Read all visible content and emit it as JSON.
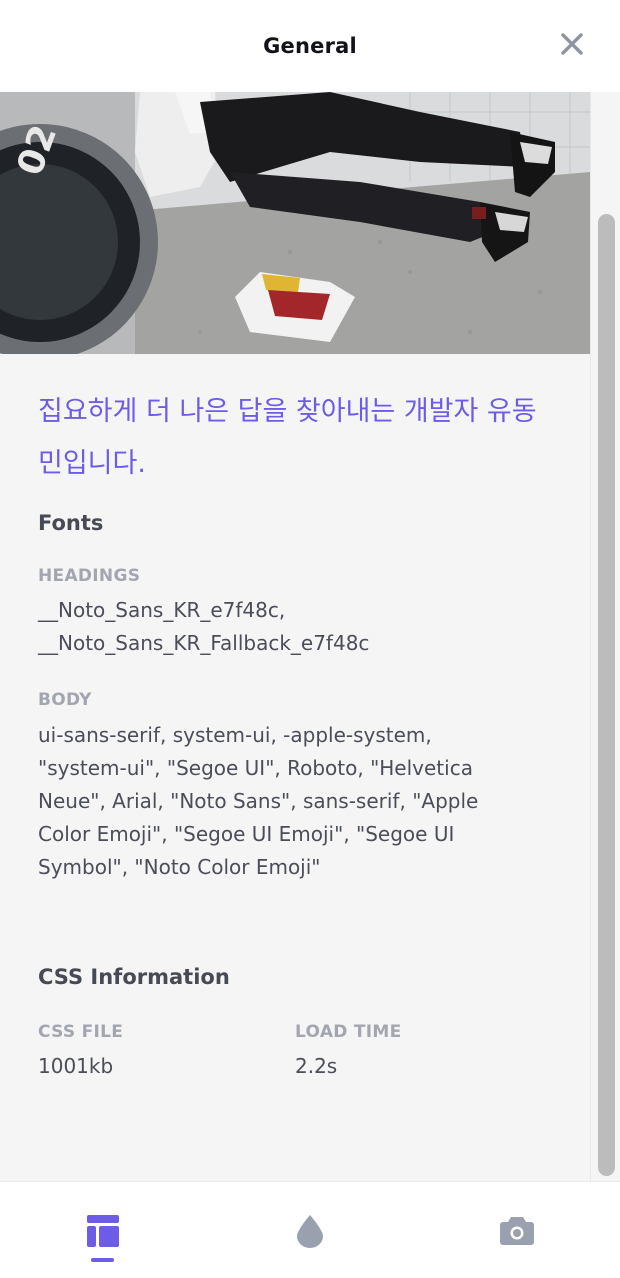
{
  "header": {
    "title": "General"
  },
  "hero": {
    "image": "person-lying-on-floor-photo"
  },
  "tagline": "집요하게 더 나은 답을 찾아내는 개발자 유동민입니다.",
  "fonts": {
    "title": "Fonts",
    "headings_label": "HEADINGS",
    "headings_value": "__Noto_Sans_KR_e7f48c, __Noto_Sans_KR_Fallback_e7f48c",
    "body_label": "BODY",
    "body_value": "ui-sans-serif, system-ui, -apple-system, \"system-ui\", \"Segoe UI\", Roboto, \"Helvetica Neue\", Arial, \"Noto Sans\", sans-serif, \"Apple Color Emoji\", \"Segoe UI Emoji\", \"Segoe UI Symbol\", \"Noto Color Emoji\""
  },
  "css_info": {
    "title": "CSS Information",
    "file_label": "CSS FILE",
    "file_value": "1001kb",
    "load_label": "LOAD TIME",
    "load_value": "2.2s"
  },
  "nav": {
    "items": [
      "layout-icon",
      "droplet-icon",
      "camera-icon"
    ],
    "active": "layout-icon"
  },
  "colors": {
    "accent": "#6c5ce7",
    "icon_inactive": "#9aa0ad",
    "background": "#f5f5f5"
  }
}
